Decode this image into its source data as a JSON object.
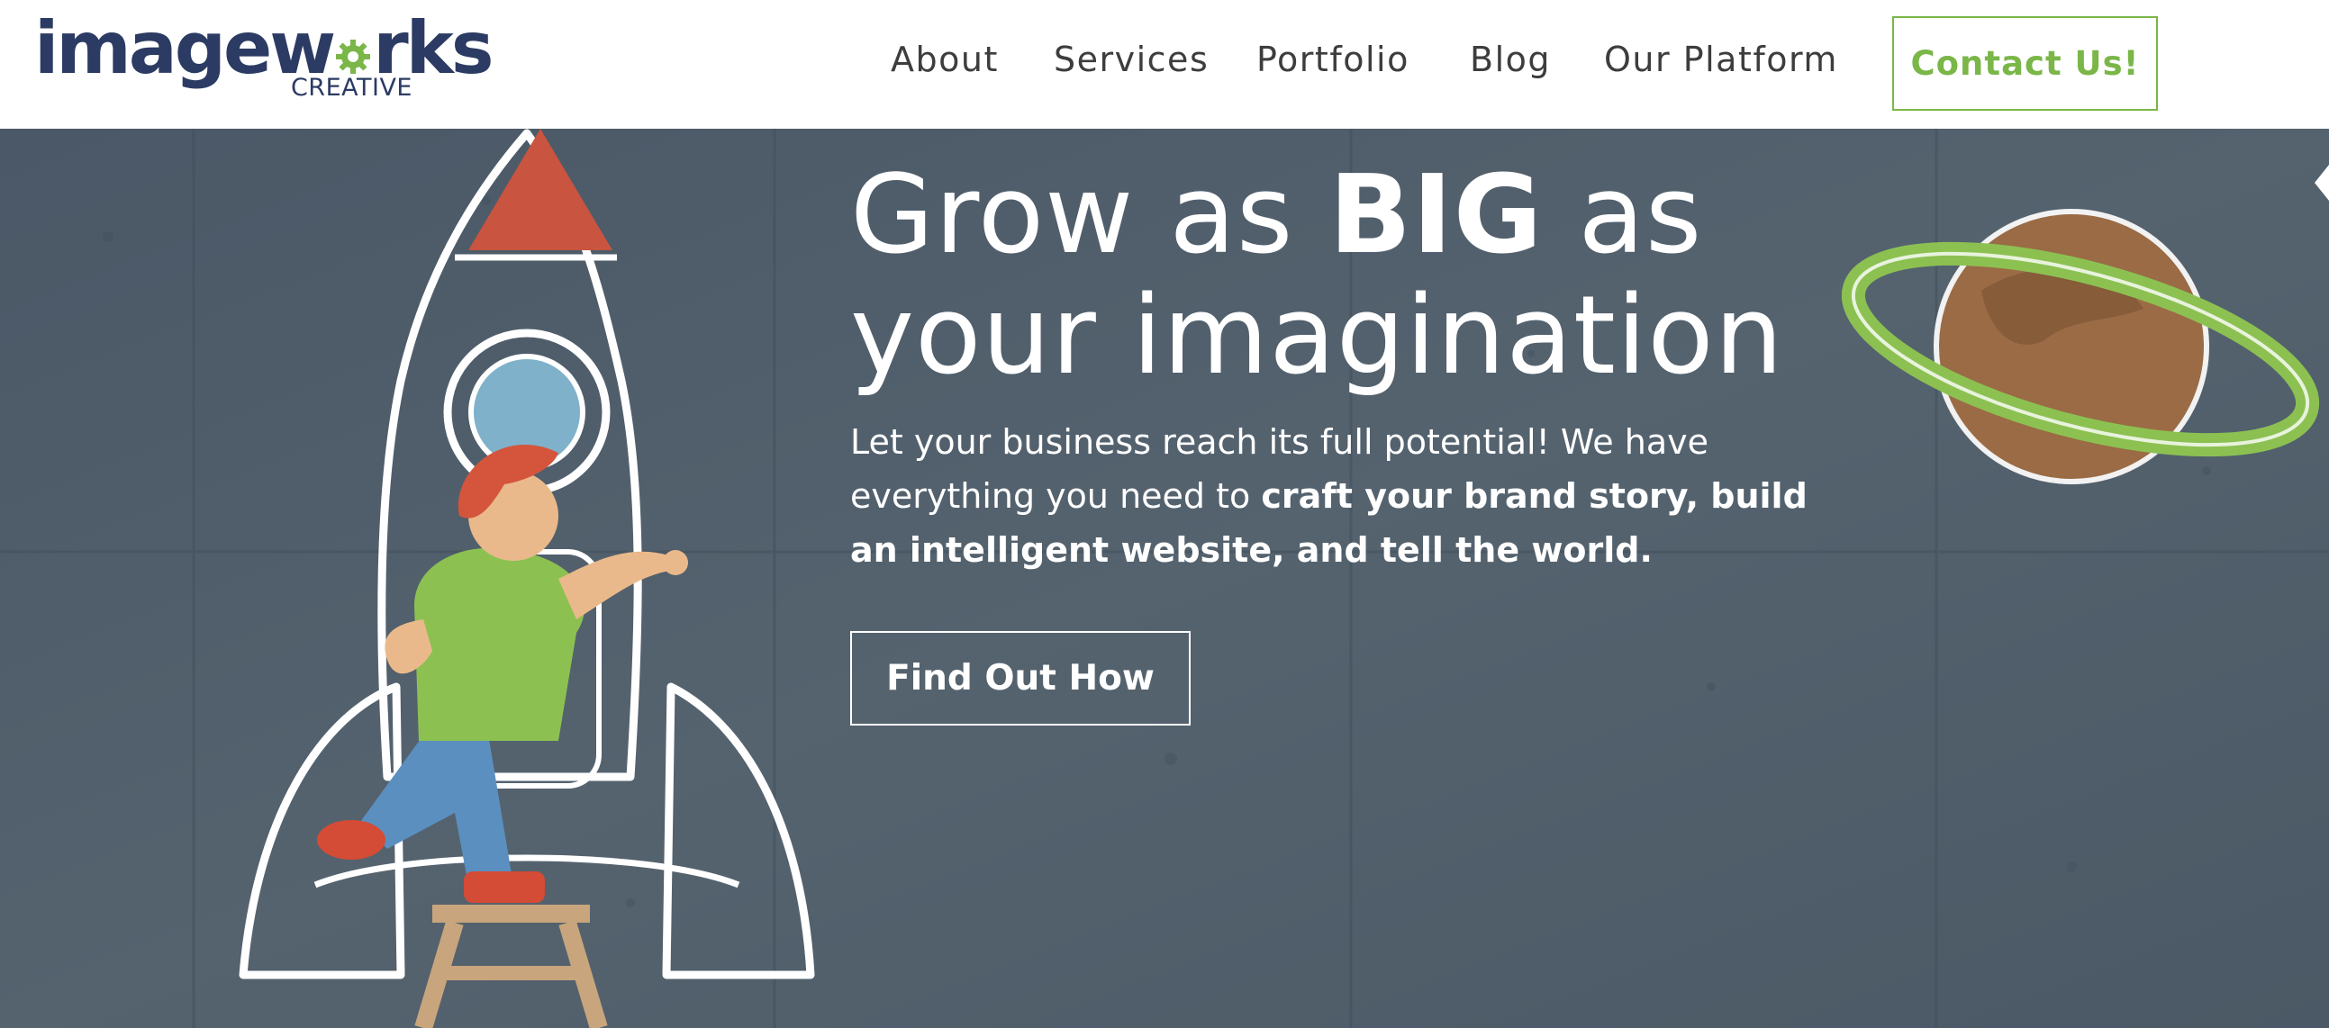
{
  "logo": {
    "main": "imageworks",
    "main_a": "image",
    "main_b": "w",
    "main_c": "rks",
    "sub": "CREATIVE"
  },
  "nav": {
    "items": [
      {
        "label": "About"
      },
      {
        "label": "Services"
      },
      {
        "label": "Portfolio"
      },
      {
        "label": "Blog"
      },
      {
        "label": "Our Platform"
      }
    ],
    "contact_label": "Contact Us!"
  },
  "hero": {
    "headline_line1_a": "Grow as ",
    "headline_line1_b": "BIG",
    "headline_line1_c": " as",
    "headline_line2": "your imagination",
    "subtext_a": "Let your business reach its full potential! We have everything you need to ",
    "subtext_b": "craft your brand story, build an intelligent website, and tell the world.",
    "cta_label": "Find Out How"
  },
  "colors": {
    "brand_navy": "#2c3b63",
    "brand_green": "#7ab648",
    "hero_bg": "#4e5d6b",
    "nav_text": "#3d3d3d"
  },
  "icons": [
    "gear-icon",
    "rocket-illustration",
    "planet-illustration",
    "star-icon"
  ]
}
